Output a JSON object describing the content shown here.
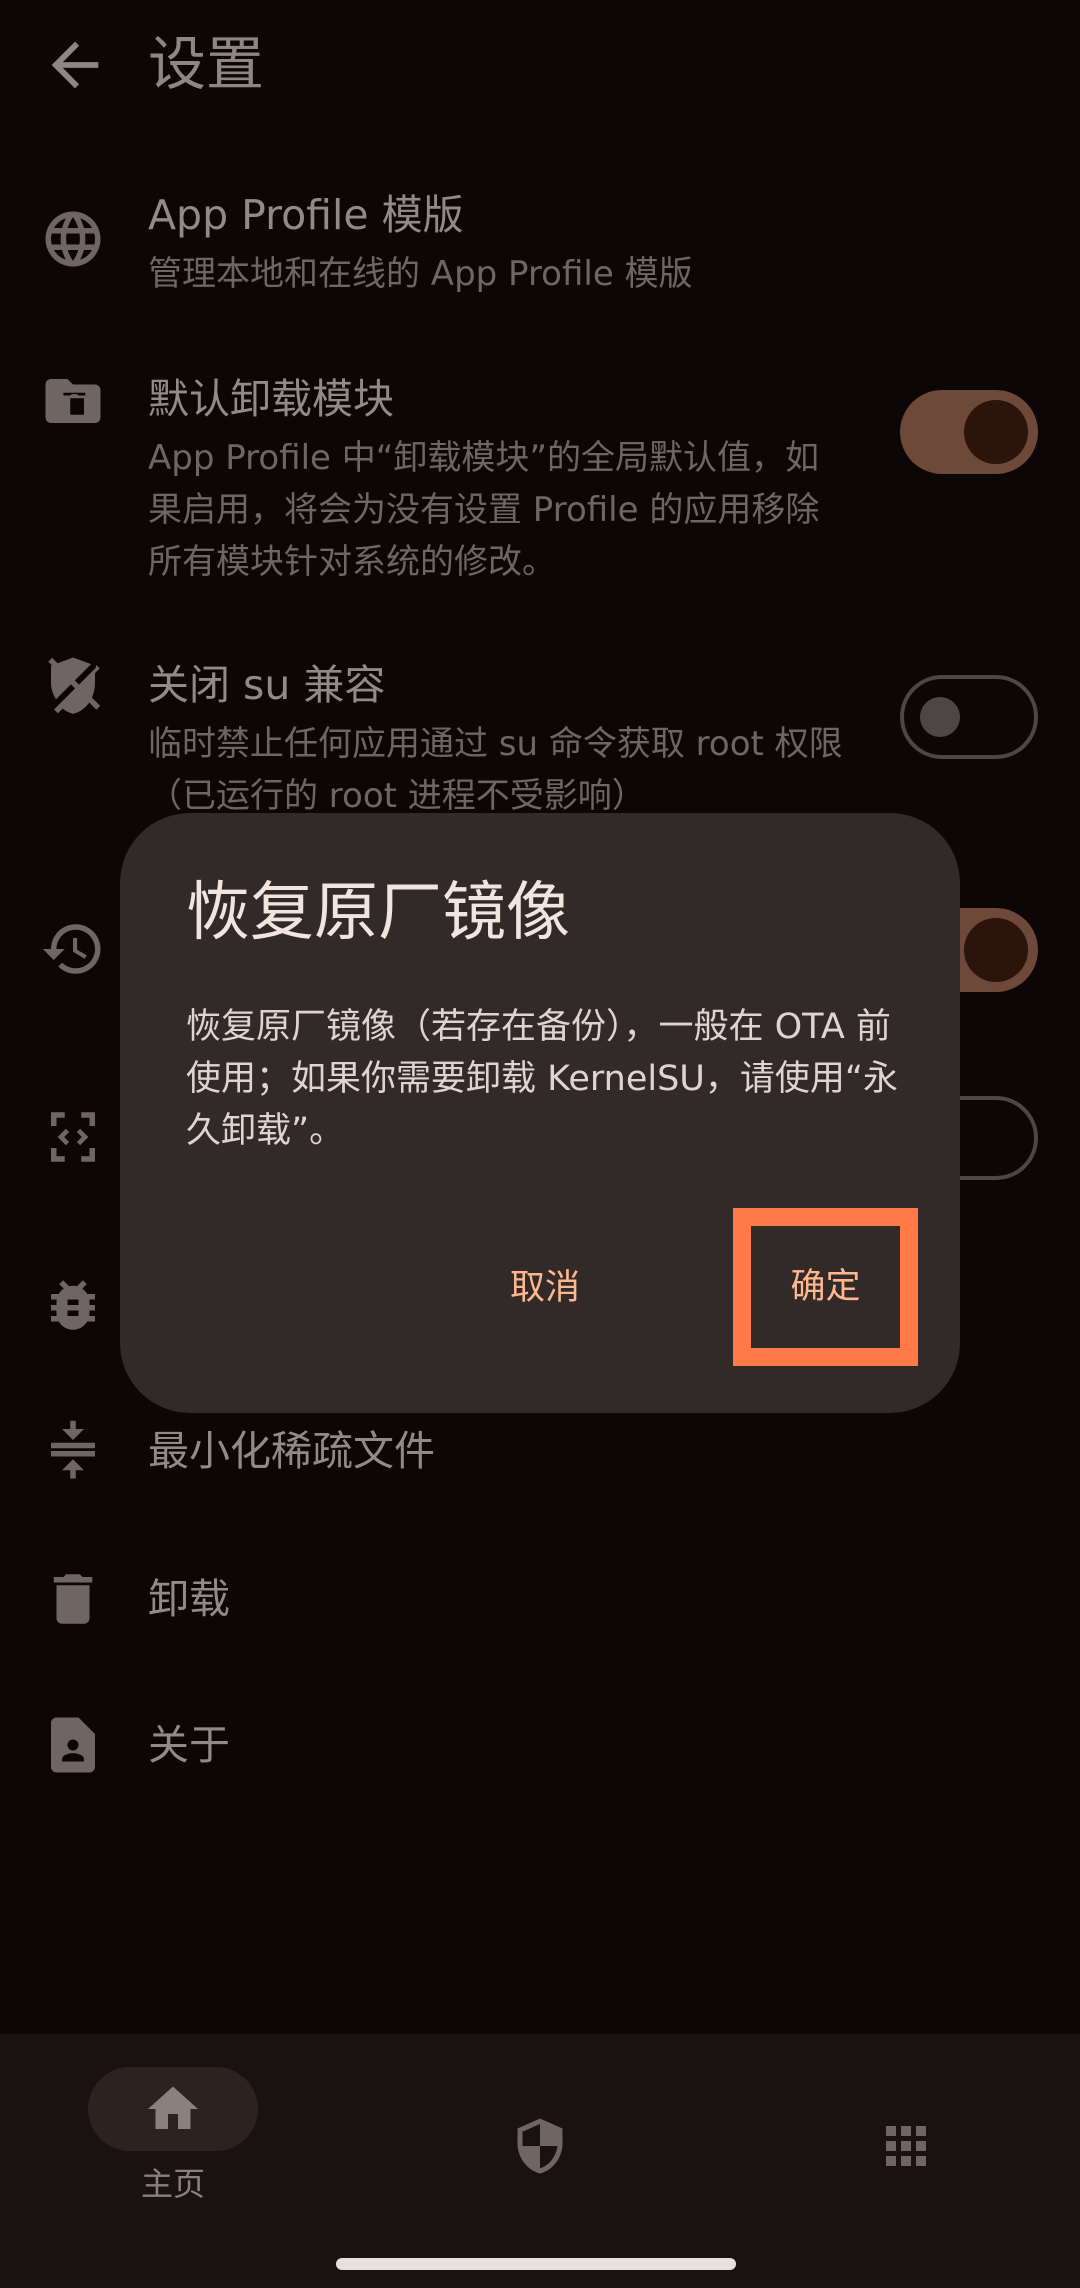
{
  "topbar": {
    "title": "设置",
    "back_icon": "arrow-back-icon"
  },
  "settings": {
    "app_profile": {
      "title": "App Profile 模版",
      "desc": "管理本地和在线的 App Profile 模版",
      "icon": "web-grid-icon"
    },
    "default_umount": {
      "title": "默认卸载模块",
      "desc": "App Profile 中“卸载模块”的全局默认值，如果启用，将会为没有设置 Profile 的应用移除所有模块针对系统的修改。",
      "icon": "folder-delete-icon",
      "enabled": true
    },
    "disable_su": {
      "title": "关闭 su 兼容",
      "desc": "临时禁止任何应用通过 su 命令获取 root 权限（已运行的 root 进程不受影响）",
      "icon": "shield-off-icon",
      "enabled": false
    },
    "restore_image": {
      "icon": "restore-icon",
      "enabled": true
    },
    "code_item": {
      "icon": "code-icon",
      "enabled": false
    },
    "debug_item": {
      "icon": "bug-icon"
    },
    "minimize_sparse": {
      "title": "最小化稀疏文件",
      "icon": "compress-icon"
    },
    "uninstall": {
      "title": "卸载",
      "icon": "trash-icon"
    },
    "about": {
      "title": "关于",
      "icon": "contact-page-icon"
    }
  },
  "dialog": {
    "title": "恢复原厂镜像",
    "message": "恢复原厂镜像（若存在备份），一般在 OTA 前使用；如果你需要卸载 KernelSU，请使用“永久卸载”。",
    "cancel_label": "取消",
    "confirm_label": "确定",
    "highlight_color": "#ff7a47"
  },
  "bottom_nav": {
    "home_label": "主页",
    "home_icon": "home-icon",
    "superuser_icon": "shield-icon",
    "modules_icon": "apps-grid-icon"
  },
  "colors": {
    "background": "#0c0606",
    "dialog_bg": "#322a28",
    "accent": "#ffb78f"
  }
}
